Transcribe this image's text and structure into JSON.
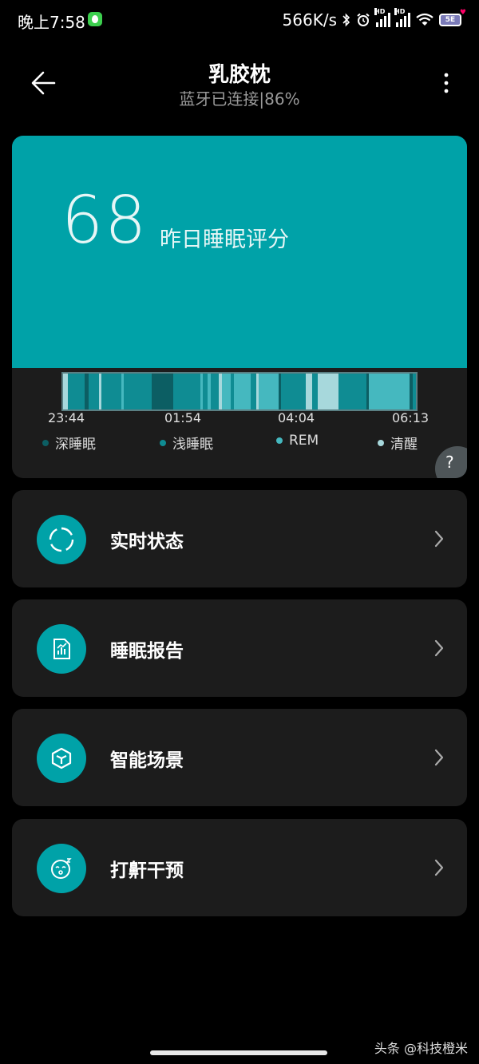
{
  "status_bar": {
    "time": "晚上7:58",
    "speed": "566K/s",
    "bluetooth_icon": "bluetooth-icon",
    "alarm_icon": "alarm-icon",
    "wifi_icon": "wifi-icon",
    "battery_label": "5E"
  },
  "header": {
    "title": "乳胶枕",
    "subtitle": "蓝牙已连接|86%"
  },
  "score": {
    "value": "68",
    "label": "昨日睡眠评分",
    "ticks": [
      "23:44",
      "01:54",
      "04:04",
      "06:13"
    ],
    "legend": [
      {
        "label": "深睡眠",
        "color": "#0c5e63"
      },
      {
        "label": "浅睡眠",
        "color": "#0f8c93"
      },
      {
        "label": "REM",
        "color": "#45b8bf"
      },
      {
        "label": "清醒",
        "color": "#a7d8dc"
      }
    ],
    "help": "?"
  },
  "sleep_stages": [
    {
      "stage": "awake",
      "minutes": 6
    },
    {
      "stage": "light",
      "minutes": 22
    },
    {
      "stage": "deep",
      "minutes": 6
    },
    {
      "stage": "light",
      "minutes": 13
    },
    {
      "stage": "awake",
      "minutes": 4
    },
    {
      "stage": "light",
      "minutes": 26
    },
    {
      "stage": "rem",
      "minutes": 3
    },
    {
      "stage": "light",
      "minutes": 37
    },
    {
      "stage": "deep",
      "minutes": 28
    },
    {
      "stage": "light",
      "minutes": 36
    },
    {
      "stage": "rem",
      "minutes": 3
    },
    {
      "stage": "light",
      "minutes": 7
    },
    {
      "stage": "rem",
      "minutes": 4
    },
    {
      "stage": "light",
      "minutes": 10
    },
    {
      "stage": "awake",
      "minutes": 4
    },
    {
      "stage": "rem",
      "minutes": 12
    },
    {
      "stage": "light",
      "minutes": 4
    },
    {
      "stage": "rem",
      "minutes": 22
    },
    {
      "stage": "light",
      "minutes": 8
    },
    {
      "stage": "awake",
      "minutes": 3
    },
    {
      "stage": "rem",
      "minutes": 26
    },
    {
      "stage": "deep",
      "minutes": 3
    },
    {
      "stage": "light",
      "minutes": 33
    },
    {
      "stage": "awake",
      "minutes": 8
    },
    {
      "stage": "light",
      "minutes": 8
    },
    {
      "stage": "awake",
      "minutes": 27
    },
    {
      "stage": "light",
      "minutes": 37
    },
    {
      "stage": "deep",
      "minutes": 3
    },
    {
      "stage": "rem",
      "minutes": 54
    },
    {
      "stage": "deep",
      "minutes": 4
    },
    {
      "stage": "light",
      "minutes": 4
    }
  ],
  "stage_colors": {
    "deep": "#0c5e63",
    "light": "#0f8c93",
    "rem": "#45b8bf",
    "awake": "#a7d8dc"
  },
  "menu": [
    {
      "label": "实时状态",
      "icon": "realtime-status-icon"
    },
    {
      "label": "睡眠报告",
      "icon": "sleep-report-icon"
    },
    {
      "label": "智能场景",
      "icon": "smart-scene-icon"
    },
    {
      "label": "打鼾干预",
      "icon": "snore-intervention-icon"
    }
  ],
  "watermark": "头条 @科技橙米"
}
